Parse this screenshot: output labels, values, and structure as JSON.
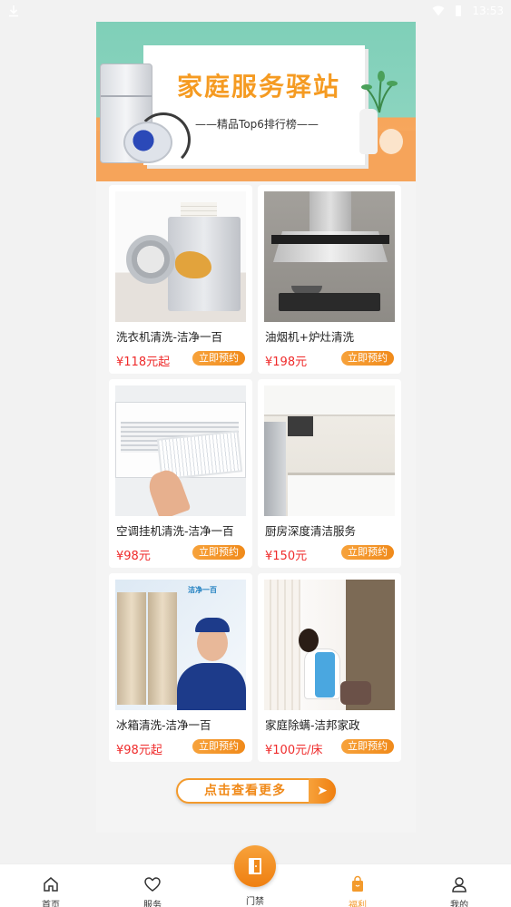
{
  "status_bar": {
    "time": "13:53"
  },
  "banner": {
    "title": "家庭服务驿站",
    "subtitle": "——精品Top6排行榜——"
  },
  "products": [
    {
      "name": "洗衣机清洗-洁净一百",
      "price": "¥118元起",
      "button": "立即预约",
      "image_icon": "washing-machine"
    },
    {
      "name": "油烟机+炉灶清洗",
      "price": "¥198元",
      "button": "立即预约",
      "image_icon": "range-hood"
    },
    {
      "name": "空调挂机清洗-洁净一百",
      "price": "¥98元",
      "button": "立即预约",
      "image_icon": "air-conditioner"
    },
    {
      "name": "厨房深度清洁服务",
      "price": "¥150元",
      "button": "立即预约",
      "image_icon": "kitchen"
    },
    {
      "name": "冰箱清洗-洁净一百",
      "price": "¥98元起",
      "button": "立即预约",
      "image_icon": "refrigerator",
      "image_badge": "洁净一百"
    },
    {
      "name": "家庭除螨-洁邦家政",
      "price": "¥100元/床",
      "button": "立即预约",
      "image_icon": "cleaning-worker"
    }
  ],
  "more_button": {
    "label": "点击查看更多"
  },
  "bottom_nav": {
    "items": [
      {
        "label": "首页",
        "icon": "home-icon"
      },
      {
        "label": "服务",
        "icon": "heart-icon"
      },
      {
        "label": "门禁",
        "icon": "door-icon"
      },
      {
        "label": "福利",
        "icon": "bag-icon",
        "active": true
      },
      {
        "label": "我的",
        "icon": "user-icon"
      }
    ]
  },
  "colors": {
    "accent": "#f39a2c",
    "price": "#ef2b2b",
    "banner_green": "#8bd4bf",
    "banner_title": "#f59b22"
  }
}
